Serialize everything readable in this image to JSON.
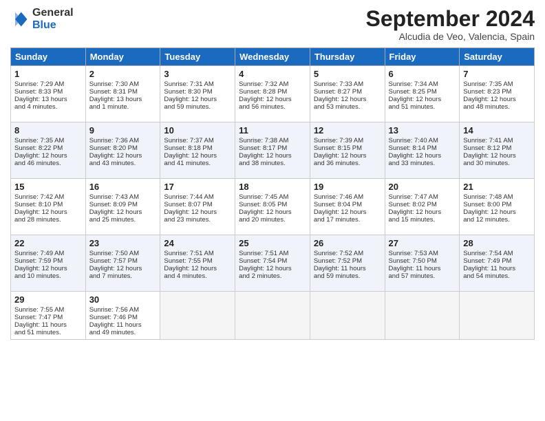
{
  "logo": {
    "general": "General",
    "blue": "Blue"
  },
  "header": {
    "month": "September 2024",
    "location": "Alcudia de Veo, Valencia, Spain"
  },
  "days_of_week": [
    "Sunday",
    "Monday",
    "Tuesday",
    "Wednesday",
    "Thursday",
    "Friday",
    "Saturday"
  ],
  "weeks": [
    [
      {
        "day": "1",
        "lines": [
          "Sunrise: 7:29 AM",
          "Sunset: 8:33 PM",
          "Daylight: 13 hours",
          "and 4 minutes."
        ]
      },
      {
        "day": "2",
        "lines": [
          "Sunrise: 7:30 AM",
          "Sunset: 8:31 PM",
          "Daylight: 13 hours",
          "and 1 minute."
        ]
      },
      {
        "day": "3",
        "lines": [
          "Sunrise: 7:31 AM",
          "Sunset: 8:30 PM",
          "Daylight: 12 hours",
          "and 59 minutes."
        ]
      },
      {
        "day": "4",
        "lines": [
          "Sunrise: 7:32 AM",
          "Sunset: 8:28 PM",
          "Daylight: 12 hours",
          "and 56 minutes."
        ]
      },
      {
        "day": "5",
        "lines": [
          "Sunrise: 7:33 AM",
          "Sunset: 8:27 PM",
          "Daylight: 12 hours",
          "and 53 minutes."
        ]
      },
      {
        "day": "6",
        "lines": [
          "Sunrise: 7:34 AM",
          "Sunset: 8:25 PM",
          "Daylight: 12 hours",
          "and 51 minutes."
        ]
      },
      {
        "day": "7",
        "lines": [
          "Sunrise: 7:35 AM",
          "Sunset: 8:23 PM",
          "Daylight: 12 hours",
          "and 48 minutes."
        ]
      }
    ],
    [
      {
        "day": "8",
        "lines": [
          "Sunrise: 7:35 AM",
          "Sunset: 8:22 PM",
          "Daylight: 12 hours",
          "and 46 minutes."
        ]
      },
      {
        "day": "9",
        "lines": [
          "Sunrise: 7:36 AM",
          "Sunset: 8:20 PM",
          "Daylight: 12 hours",
          "and 43 minutes."
        ]
      },
      {
        "day": "10",
        "lines": [
          "Sunrise: 7:37 AM",
          "Sunset: 8:18 PM",
          "Daylight: 12 hours",
          "and 41 minutes."
        ]
      },
      {
        "day": "11",
        "lines": [
          "Sunrise: 7:38 AM",
          "Sunset: 8:17 PM",
          "Daylight: 12 hours",
          "and 38 minutes."
        ]
      },
      {
        "day": "12",
        "lines": [
          "Sunrise: 7:39 AM",
          "Sunset: 8:15 PM",
          "Daylight: 12 hours",
          "and 36 minutes."
        ]
      },
      {
        "day": "13",
        "lines": [
          "Sunrise: 7:40 AM",
          "Sunset: 8:14 PM",
          "Daylight: 12 hours",
          "and 33 minutes."
        ]
      },
      {
        "day": "14",
        "lines": [
          "Sunrise: 7:41 AM",
          "Sunset: 8:12 PM",
          "Daylight: 12 hours",
          "and 30 minutes."
        ]
      }
    ],
    [
      {
        "day": "15",
        "lines": [
          "Sunrise: 7:42 AM",
          "Sunset: 8:10 PM",
          "Daylight: 12 hours",
          "and 28 minutes."
        ]
      },
      {
        "day": "16",
        "lines": [
          "Sunrise: 7:43 AM",
          "Sunset: 8:09 PM",
          "Daylight: 12 hours",
          "and 25 minutes."
        ]
      },
      {
        "day": "17",
        "lines": [
          "Sunrise: 7:44 AM",
          "Sunset: 8:07 PM",
          "Daylight: 12 hours",
          "and 23 minutes."
        ]
      },
      {
        "day": "18",
        "lines": [
          "Sunrise: 7:45 AM",
          "Sunset: 8:05 PM",
          "Daylight: 12 hours",
          "and 20 minutes."
        ]
      },
      {
        "day": "19",
        "lines": [
          "Sunrise: 7:46 AM",
          "Sunset: 8:04 PM",
          "Daylight: 12 hours",
          "and 17 minutes."
        ]
      },
      {
        "day": "20",
        "lines": [
          "Sunrise: 7:47 AM",
          "Sunset: 8:02 PM",
          "Daylight: 12 hours",
          "and 15 minutes."
        ]
      },
      {
        "day": "21",
        "lines": [
          "Sunrise: 7:48 AM",
          "Sunset: 8:00 PM",
          "Daylight: 12 hours",
          "and 12 minutes."
        ]
      }
    ],
    [
      {
        "day": "22",
        "lines": [
          "Sunrise: 7:49 AM",
          "Sunset: 7:59 PM",
          "Daylight: 12 hours",
          "and 10 minutes."
        ]
      },
      {
        "day": "23",
        "lines": [
          "Sunrise: 7:50 AM",
          "Sunset: 7:57 PM",
          "Daylight: 12 hours",
          "and 7 minutes."
        ]
      },
      {
        "day": "24",
        "lines": [
          "Sunrise: 7:51 AM",
          "Sunset: 7:55 PM",
          "Daylight: 12 hours",
          "and 4 minutes."
        ]
      },
      {
        "day": "25",
        "lines": [
          "Sunrise: 7:51 AM",
          "Sunset: 7:54 PM",
          "Daylight: 12 hours",
          "and 2 minutes."
        ]
      },
      {
        "day": "26",
        "lines": [
          "Sunrise: 7:52 AM",
          "Sunset: 7:52 PM",
          "Daylight: 11 hours",
          "and 59 minutes."
        ]
      },
      {
        "day": "27",
        "lines": [
          "Sunrise: 7:53 AM",
          "Sunset: 7:50 PM",
          "Daylight: 11 hours",
          "and 57 minutes."
        ]
      },
      {
        "day": "28",
        "lines": [
          "Sunrise: 7:54 AM",
          "Sunset: 7:49 PM",
          "Daylight: 11 hours",
          "and 54 minutes."
        ]
      }
    ],
    [
      {
        "day": "29",
        "lines": [
          "Sunrise: 7:55 AM",
          "Sunset: 7:47 PM",
          "Daylight: 11 hours",
          "and 51 minutes."
        ]
      },
      {
        "day": "30",
        "lines": [
          "Sunrise: 7:56 AM",
          "Sunset: 7:46 PM",
          "Daylight: 11 hours",
          "and 49 minutes."
        ]
      },
      null,
      null,
      null,
      null,
      null
    ]
  ]
}
